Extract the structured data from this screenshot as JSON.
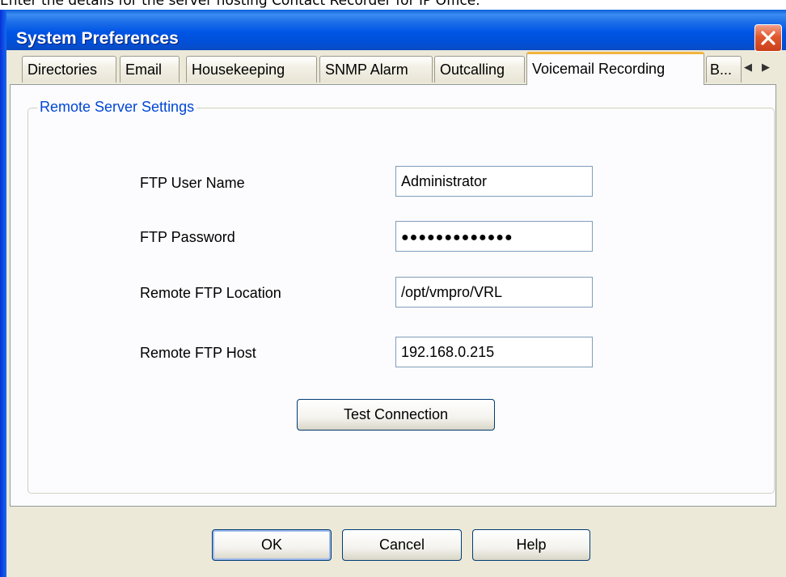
{
  "caption": "Enter the details for the server hosting Contact Recorder for IP Office.",
  "window": {
    "title": "System Preferences"
  },
  "tabs": [
    {
      "label": "Directories"
    },
    {
      "label": "Email"
    },
    {
      "label": "Housekeeping"
    },
    {
      "label": "SNMP Alarm"
    },
    {
      "label": "Outcalling"
    },
    {
      "label": "Voicemail Recording"
    },
    {
      "label": "B..."
    }
  ],
  "active_tab": "Voicemail Recording",
  "group": {
    "title": "Remote Server Settings"
  },
  "fields": {
    "ftp_user_name": {
      "label": "FTP User Name",
      "value": "Administrator"
    },
    "ftp_password": {
      "label": "FTP Password",
      "value": "●●●●●●●●●●●●●"
    },
    "remote_ftp_location": {
      "label": "Remote FTP Location",
      "value": "/opt/vmpro/VRL"
    },
    "remote_ftp_host": {
      "label": "Remote FTP Host",
      "value": "192.168.0.215"
    }
  },
  "buttons": {
    "test_connection": "Test Connection",
    "ok": "OK",
    "cancel": "Cancel",
    "help": "Help"
  },
  "icons": {
    "close": "close-icon",
    "tab_scroll_left": "chevron-left-icon",
    "tab_scroll_right": "chevron-right-icon"
  },
  "colors": {
    "titlebar": "#0055e5",
    "close_button": "#e2582c",
    "group_title": "#0046d5",
    "active_tab_accent": "#f2b33d",
    "dialog_background": "#ece9d8"
  }
}
